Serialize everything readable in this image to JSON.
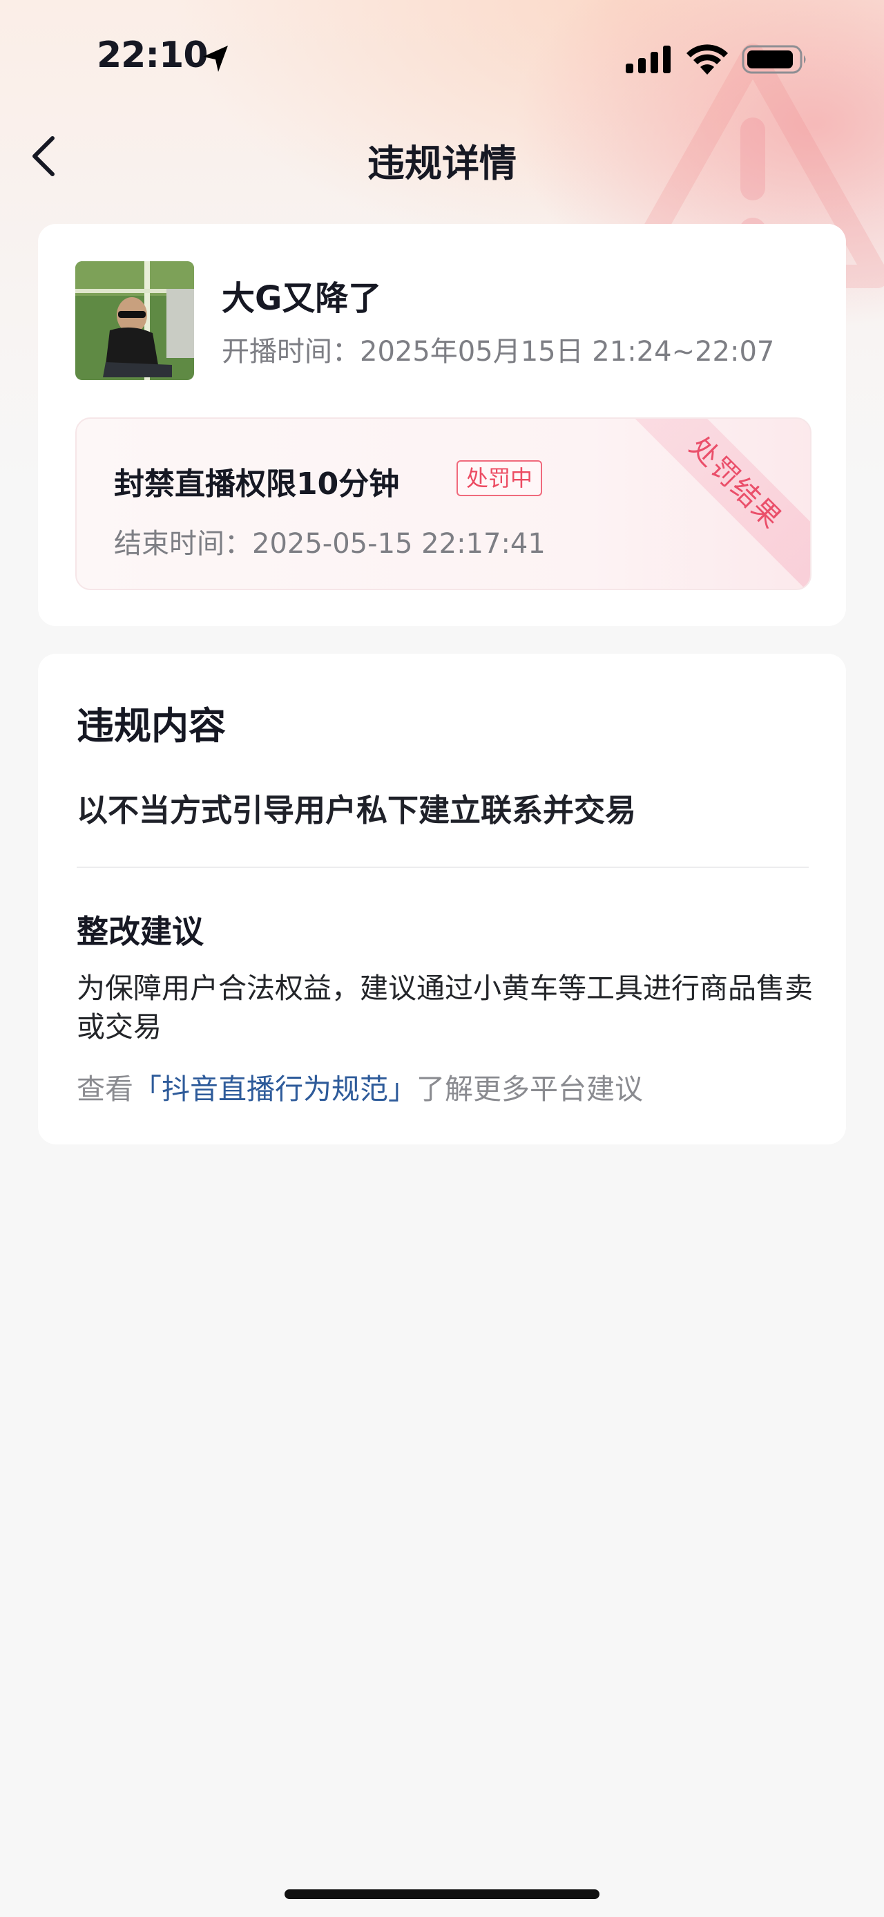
{
  "status_bar": {
    "time": "22:10",
    "icons": [
      "location-arrow-icon",
      "cellular-signal-icon",
      "wifi-icon",
      "battery-icon"
    ]
  },
  "nav": {
    "back_icon": "chevron-left-icon",
    "title": "违规详情"
  },
  "stream": {
    "title": "大G又降了",
    "time_label": "开播时间：",
    "time_value": "2025年05月15日 21:24~22:07"
  },
  "penalty": {
    "title": "封禁直播权限10分钟",
    "status_badge": "处罚中",
    "end_label": "结束时间：",
    "end_value": "2025-05-15 22:17:41",
    "ribbon": "处罚结果"
  },
  "violation": {
    "section_title": "违规内容",
    "content": "以不当方式引导用户私下建立联系并交易",
    "suggestion_title": "整改建议",
    "suggestion_text": "为保障用户合法权益，建议通过小黄车等工具进行商品售卖或交易",
    "guide_prefix": "查看",
    "guide_link": "「抖音直播行为规范」",
    "guide_suffix": "了解更多平台建议"
  },
  "colors": {
    "accent_red": "#ec4b62",
    "link_blue": "#2e5b9a",
    "text_secondary": "#7d7e84"
  }
}
